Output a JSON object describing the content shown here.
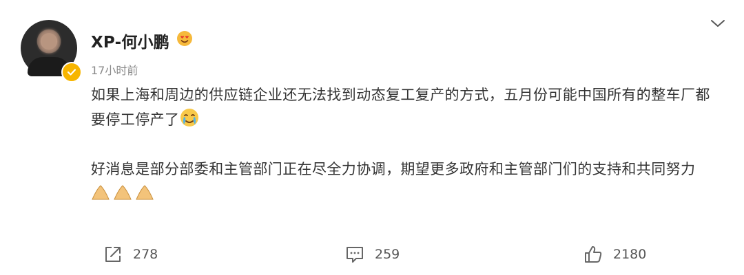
{
  "post": {
    "author": "XP-何小鹏",
    "time": "17小时前",
    "paragraph1": "如果上海和周边的供应链企业还无法找到动态复工复产的方式，五月份可能中国所有的整车厂都要停工停产了",
    "paragraph2": "好消息是部分部委和主管部门正在尽全力协调，期望更多政府和主管部门们的支持和共同努力"
  },
  "icons": {
    "author_badge": "heart-eyes-emoji-icon",
    "verified": "verified-badge-icon",
    "menu": "chevron-down-icon",
    "para1_end": "crying-emoji-icon",
    "para2_end": "praying-hands-emoji-icon"
  },
  "actions": {
    "repost_count": "278",
    "comment_count": "259",
    "like_count": "2180"
  },
  "colors": {
    "verified": "#f7b500",
    "text": "#333333",
    "muted": "#8a8a8a"
  }
}
